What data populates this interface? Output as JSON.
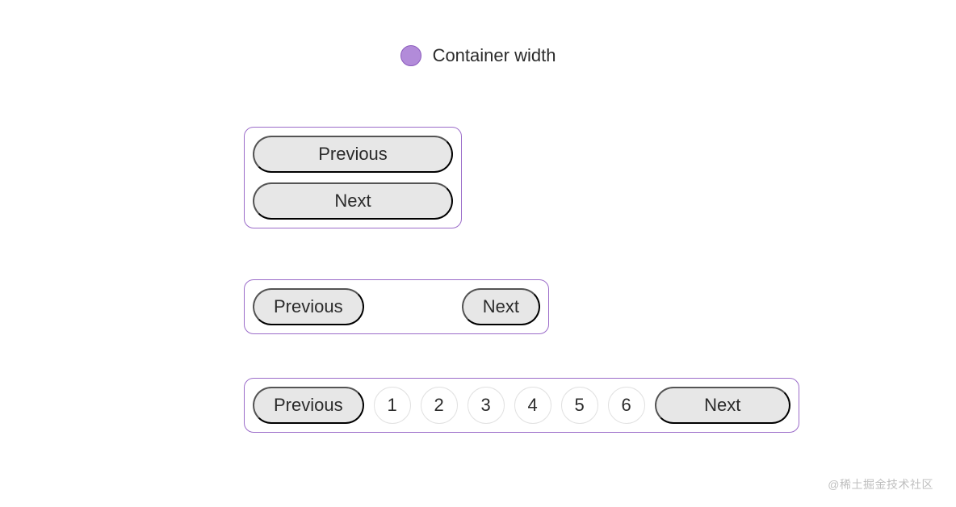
{
  "legend": {
    "label": "Container width",
    "dot_color": "#b28bd9"
  },
  "labels": {
    "prev": "Previous",
    "next": "Next"
  },
  "pages": [
    "1",
    "2",
    "3",
    "4",
    "5",
    "6"
  ],
  "watermark": "@稀土掘金技术社区"
}
